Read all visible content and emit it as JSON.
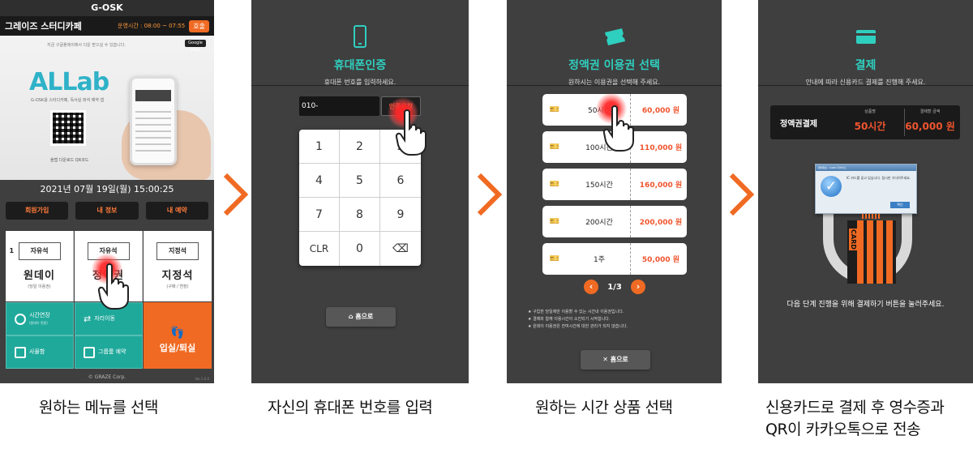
{
  "panel1": {
    "top_title": "G-OSK",
    "store_name": "그레이즈 스터디카페",
    "hours": "운영시간 : 08:00 ~ 07:55",
    "call_button": "호출",
    "banner": {
      "note": "지금 구글플레이에서 다운 받으실 수 있습니다.",
      "google_play": "Google Play",
      "logo": "ALLab",
      "sub": "G-OSK용 스터디카페, 독서실 좌석 예약 앱",
      "qr_label": "올랩 다운로드 QR코드"
    },
    "datetime": "2021년 07월 19일(월) 15:00:25",
    "top_buttons": [
      "회원가입",
      "내 정보",
      "내 예약"
    ],
    "tickets": [
      {
        "tag": "자유석",
        "label": "원데이",
        "sub": "(당일 이용권)"
      },
      {
        "tag": "자유석",
        "label": "정액권",
        "sub": ""
      },
      {
        "tag": "지정석",
        "label": "지정석",
        "sub": "(구매 / 연장)"
      }
    ],
    "tiles": [
      {
        "label": "시간연장",
        "sub": "(원데이 전용)"
      },
      {
        "label": "자리이동",
        "sub": ""
      },
      {
        "label": "사물함",
        "sub": ""
      },
      {
        "label": "그룹룸 예약",
        "sub": ""
      }
    ],
    "enter_exit": "입실/퇴실",
    "copyright": "© GRAZE Corp.",
    "version": "Ver.1.0.0"
  },
  "panel2": {
    "title": "휴대폰인증",
    "desc": "휴대폰 번호를 입력하세요.",
    "phone_value": "010-",
    "auth_button": "인증요청",
    "keys": [
      "1",
      "2",
      "3",
      "4",
      "5",
      "6",
      "7",
      "8",
      "9",
      "CLR",
      "0",
      "⌫"
    ],
    "home_button": "홈으로"
  },
  "panel3": {
    "title": "정액권 이용권 선택",
    "desc": "원하시는 이용권을 선택해 주세요.",
    "products": [
      {
        "name": "50시간",
        "price": "60,000 원"
      },
      {
        "name": "100시간",
        "price": "110,000 원"
      },
      {
        "name": "150시간",
        "price": "160,000 원"
      },
      {
        "name": "200시간",
        "price": "200,000 원"
      },
      {
        "name": "1주",
        "price": "50,000 원"
      }
    ],
    "page": "1/3",
    "notes": [
      "★ 구입한 당일에만 이용할 수 있는 시간내 이용권입니다.",
      "★ 결제와 함께 이용시간이 소진되기 시작합니다.",
      "★ 원데이 이용권은 잔여시간에 대한 관리가 되지 않습니다."
    ],
    "home_button": "홈으로"
  },
  "panel4": {
    "title": "결제",
    "desc": "안내에 따라 신용카드 결제를 진행해 주세요.",
    "summary_label": "정액권결제",
    "product_header": "상품명",
    "product_value": "50시간",
    "amount_header": "결제할 금액",
    "amount_value": "60,000 원",
    "dialog_title": "결제정보 - CARD 디바이스",
    "dialog_msg": "IC 카드를 꽂고 있습니다. 잠시만 기다려주세요.",
    "dialog_ok": "확인",
    "card_text": "CARD",
    "message": "다음 단계 진행을 위해 결제하기 버튼을 눌러주세요."
  },
  "captions": {
    "step1": "원하는 메뉴를 선택",
    "step2": "자신의 휴대폰 번호를 입력",
    "step3": "원하는 시간 상품 선택",
    "step4_line1": "신용카드로 결제 후 영수증과",
    "step4_line2": "QR이 카카오톡으로 전송"
  },
  "colors": {
    "accent_orange": "#f06a23",
    "accent_teal": "#2fcfbf",
    "screen_bg": "#3f3f3f"
  }
}
